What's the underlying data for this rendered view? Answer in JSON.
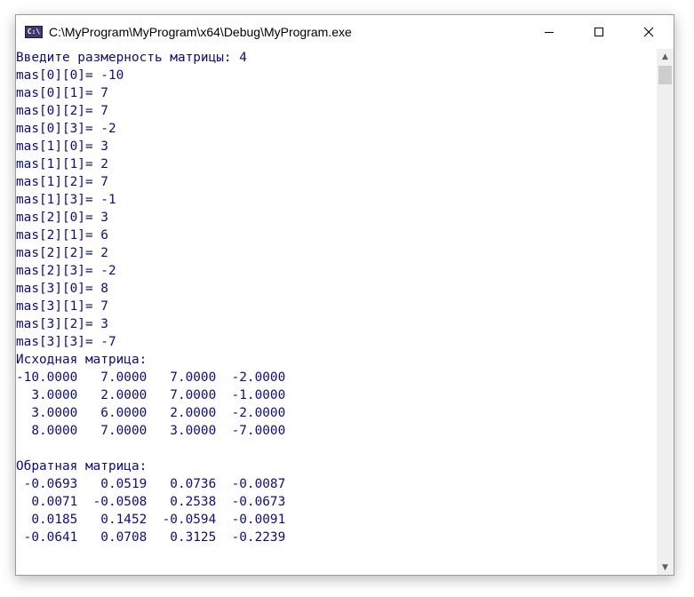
{
  "window": {
    "title": "C:\\MyProgram\\MyProgram\\x64\\Debug\\MyProgram.exe",
    "icon_label": "C:\\",
    "icons": {
      "app": "console-app-icon",
      "minimize": "minimize-icon",
      "maximize": "maximize-icon",
      "close": "close-icon",
      "scroll_up": "chevron-up-icon",
      "scroll_down": "chevron-down-icon"
    }
  },
  "console": {
    "lines": [
      "Введите размерность матрицы: 4",
      "mas[0][0]= -10",
      "mas[0][1]= 7",
      "mas[0][2]= 7",
      "mas[0][3]= -2",
      "mas[1][0]= 3",
      "mas[1][1]= 2",
      "mas[1][2]= 7",
      "mas[1][3]= -1",
      "mas[2][0]= 3",
      "mas[2][1]= 6",
      "mas[2][2]= 2",
      "mas[2][3]= -2",
      "mas[3][0]= 8",
      "mas[3][1]= 7",
      "mas[3][2]= 3",
      "mas[3][3]= -7",
      "Исходная матрица:",
      "-10.0000   7.0000   7.0000  -2.0000",
      "  3.0000   2.0000   7.0000  -1.0000",
      "  3.0000   6.0000   2.0000  -2.0000",
      "  8.0000   7.0000   3.0000  -7.0000",
      "",
      "Обратная матрица:",
      " -0.0693   0.0519   0.0736  -0.0087",
      "  0.0071  -0.0508   0.2538  -0.0673",
      "  0.0185   0.1452  -0.0594  -0.0091",
      " -0.0641   0.0708   0.3125  -0.2239"
    ],
    "text_color": "#0d0d7a",
    "background": "#ffffff"
  }
}
